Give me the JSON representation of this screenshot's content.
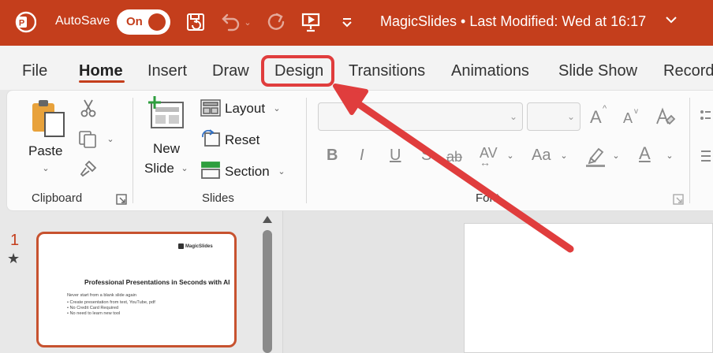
{
  "titlebar": {
    "autosave_label": "AutoSave",
    "autosave_state": "On",
    "doc_title": "MagicSlides • Last Modified: Wed at 16:17",
    "color": "#c43e1c"
  },
  "tabs": [
    {
      "label": "File"
    },
    {
      "label": "Home",
      "active": true
    },
    {
      "label": "Insert"
    },
    {
      "label": "Draw"
    },
    {
      "label": "Design",
      "highlighted": true
    },
    {
      "label": "Transitions"
    },
    {
      "label": "Animations"
    },
    {
      "label": "Slide Show"
    },
    {
      "label": "Record"
    }
  ],
  "ribbon": {
    "clipboard": {
      "paste_label": "Paste",
      "group_label": "Clipboard"
    },
    "slides": {
      "new_label_1": "New",
      "new_label_2": "Slide",
      "layout_label": "Layout",
      "reset_label": "Reset",
      "section_label": "Section",
      "group_label": "Slides"
    },
    "font": {
      "group_label": "Font",
      "grow_glyph": "A",
      "shrink_glyph": "A",
      "bold": "B",
      "italic": "I",
      "underline": "U",
      "strike": "S",
      "strikeout": "ab",
      "spacing": "AV",
      "case": "Aa",
      "color_a": "A"
    }
  },
  "slides_pane": {
    "slide_number": "1",
    "star": "★",
    "thumbnail": {
      "brand": "MagicSlides",
      "title": "Professional Presentations in Seconds with AI",
      "lines": [
        "Never start from a blank slide again",
        "• Create presentation from text, YouTube, pdf",
        "• No Credit Card Required",
        "• No need to learn new tool"
      ]
    }
  },
  "annotation": {
    "highlight_color": "#e03d3d"
  }
}
